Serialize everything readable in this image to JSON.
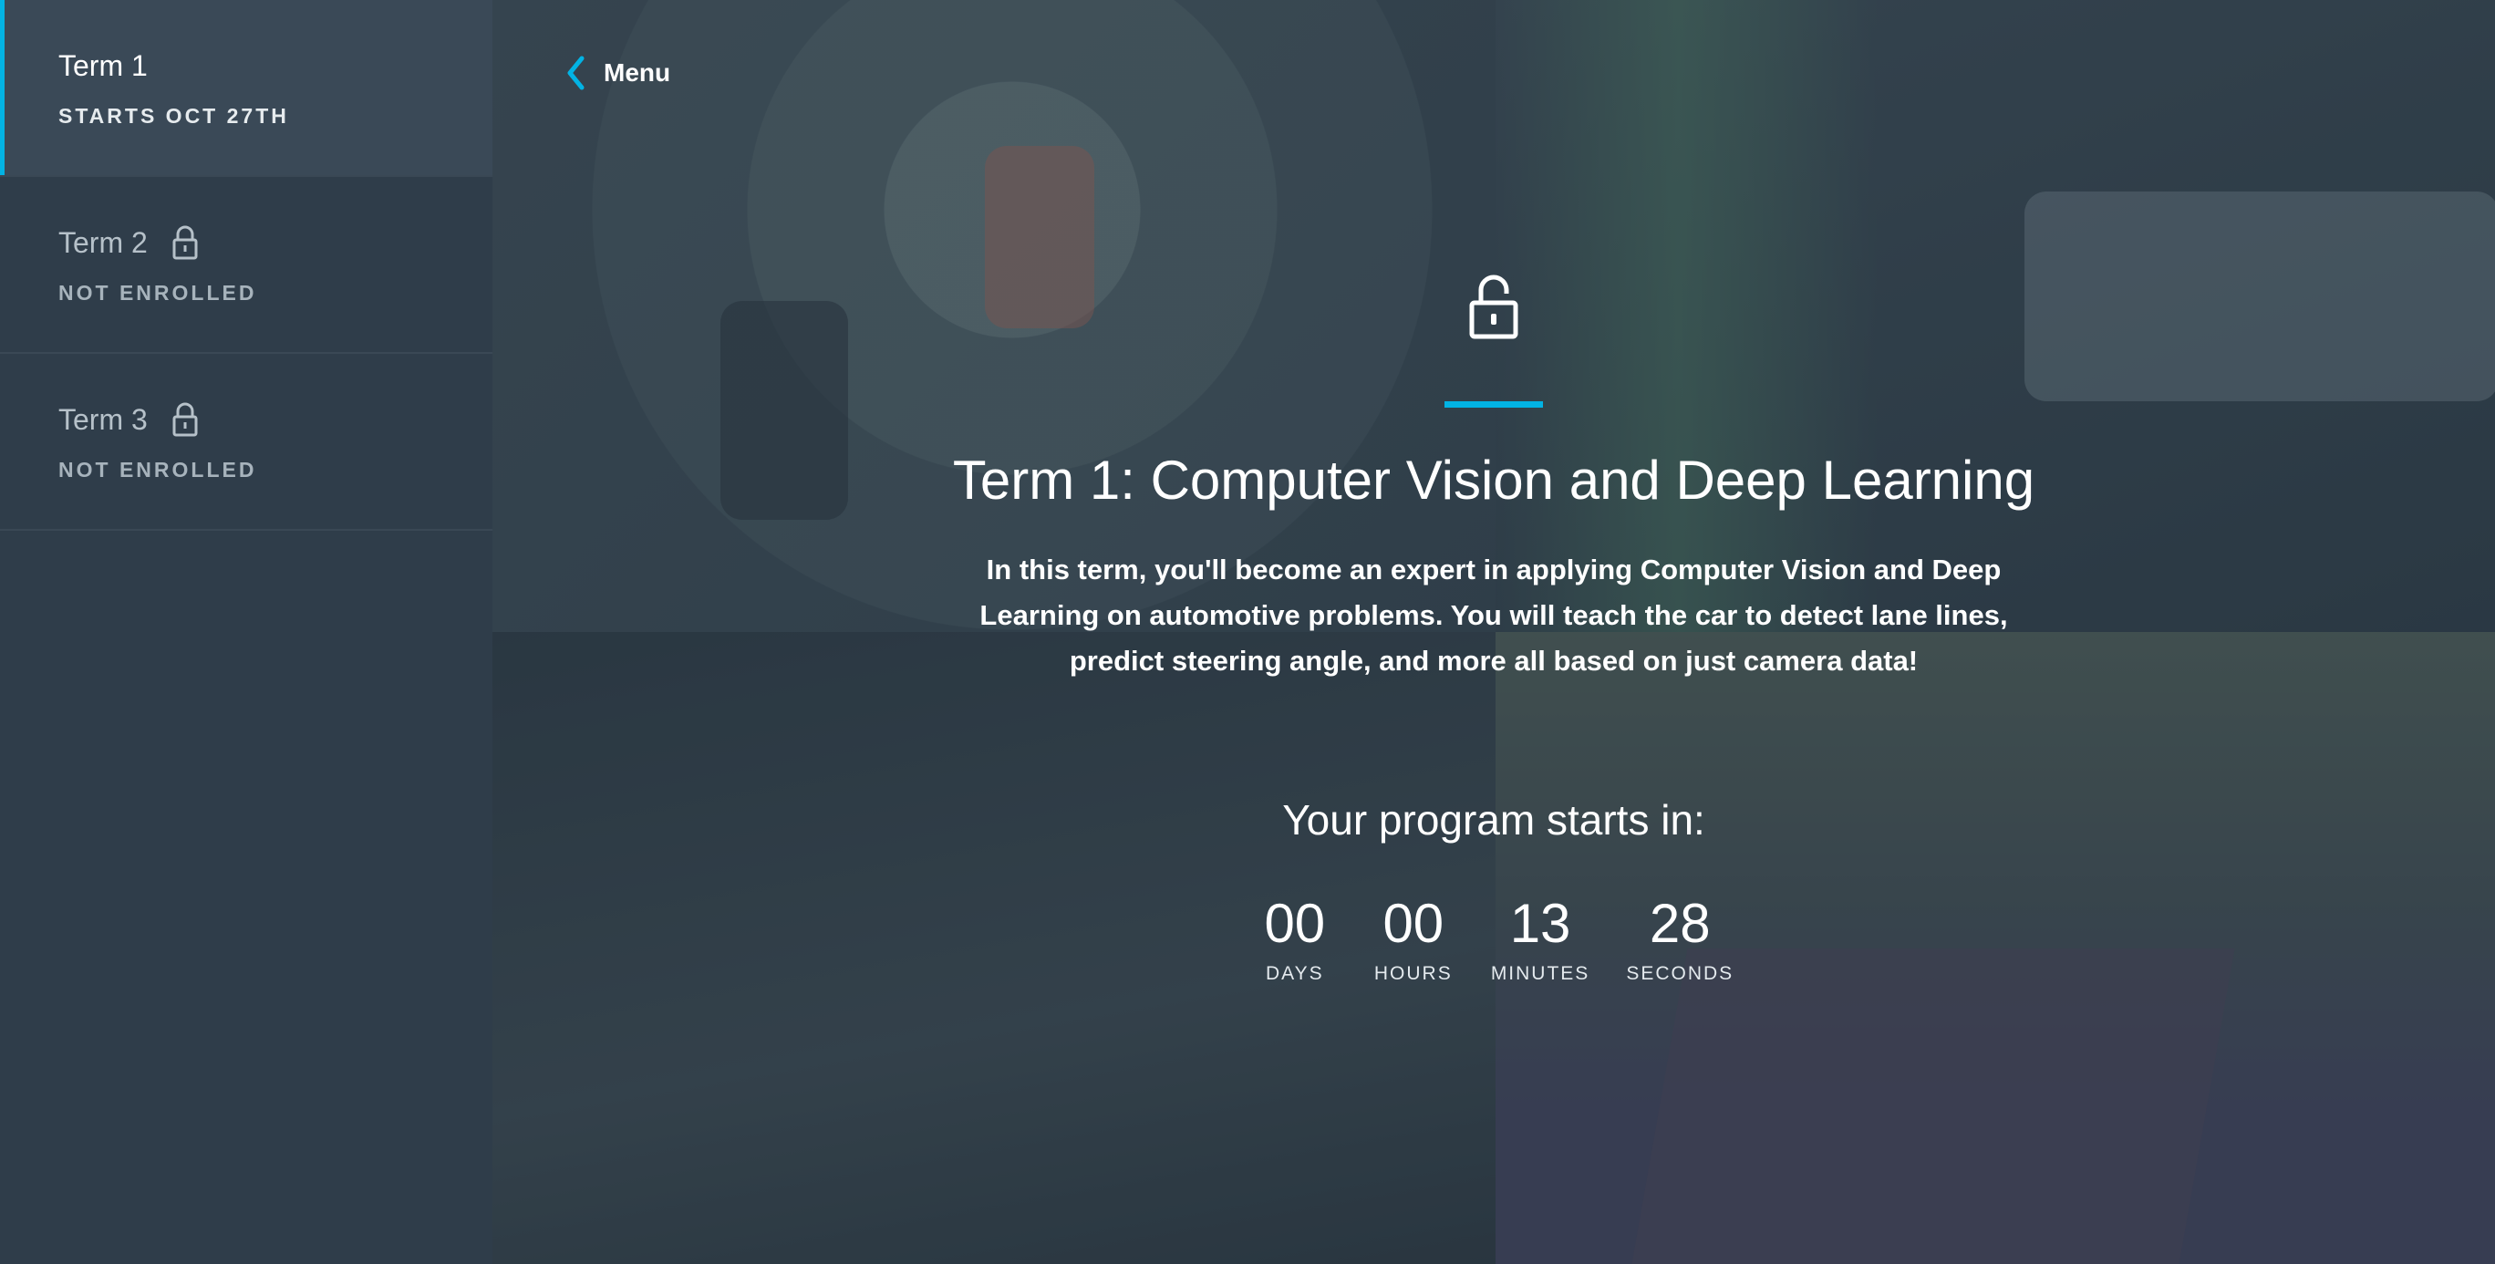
{
  "sidebar": {
    "terms": [
      {
        "title": "Term 1",
        "status": "STARTS OCT 27TH",
        "locked": false,
        "active": true
      },
      {
        "title": "Term 2",
        "status": "NOT ENROLLED",
        "locked": true,
        "active": false
      },
      {
        "title": "Term 3",
        "status": "NOT ENROLLED",
        "locked": true,
        "active": false
      }
    ]
  },
  "header": {
    "menu_label": "Menu"
  },
  "main": {
    "title": "Term 1: Computer Vision and Deep Learning",
    "description": "In this term, you'll become an expert in applying Computer Vision and Deep Learning on automotive problems. You will teach the car to detect lane lines, predict steering angle, and more all based on just camera data!",
    "starts_label": "Your program starts in:",
    "countdown": [
      {
        "value": "00",
        "label": "DAYS"
      },
      {
        "value": "00",
        "label": "HOURS"
      },
      {
        "value": "13",
        "label": "MINUTES"
      },
      {
        "value": "28",
        "label": "SECONDS"
      }
    ]
  },
  "colors": {
    "accent": "#02b3e4",
    "sidebar_bg": "#2f3d4a",
    "active_bg": "#3a4957"
  },
  "icons": {
    "unlocked": "unlock-icon",
    "locked": "lock-icon",
    "back": "chevron-left-icon"
  }
}
